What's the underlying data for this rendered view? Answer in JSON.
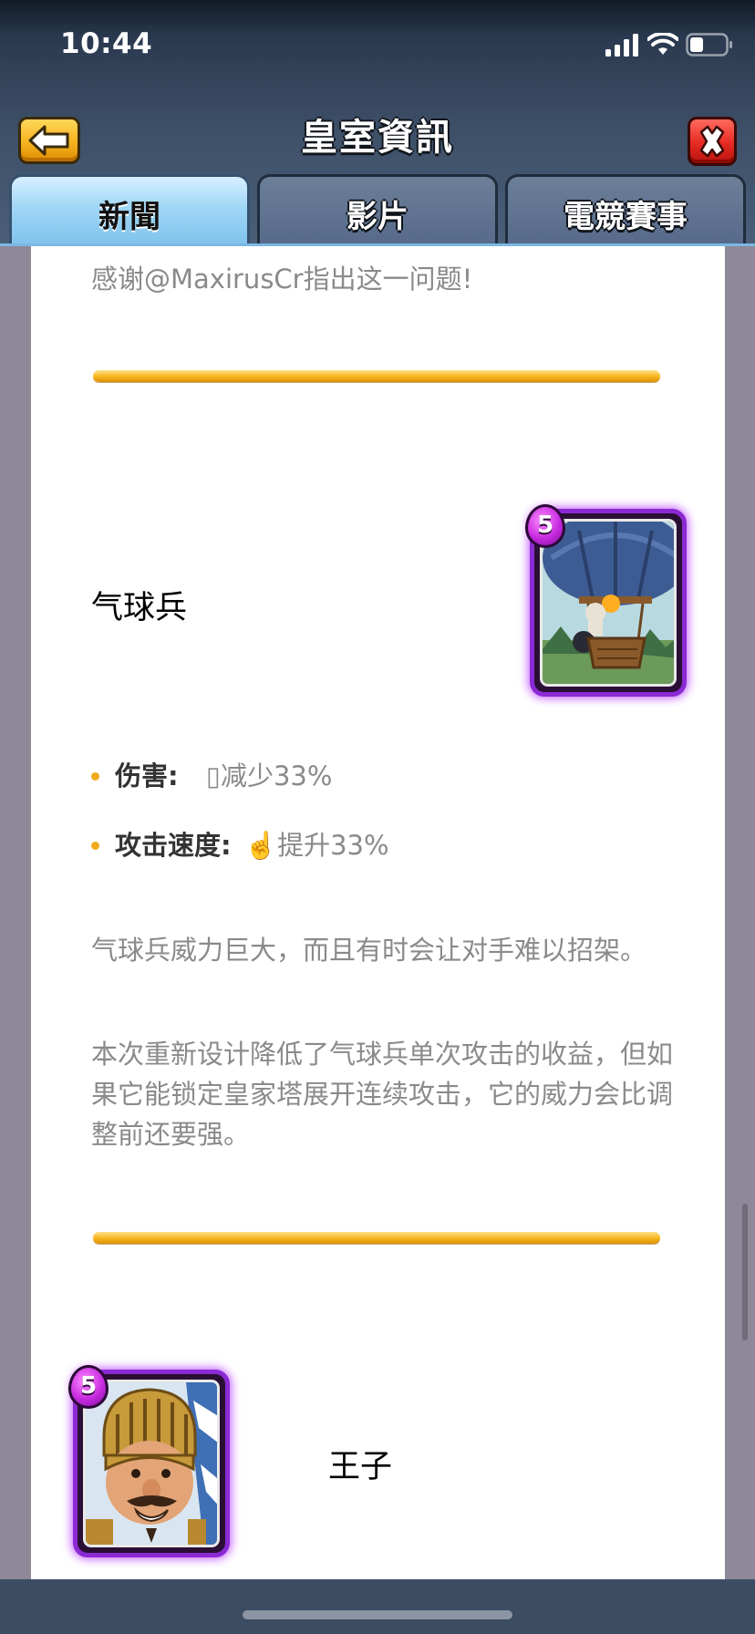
{
  "status_bar": {
    "time": "10:44",
    "icons": [
      "cellular-signal-icon",
      "wifi-icon",
      "battery-icon"
    ]
  },
  "nav": {
    "title": "皇室資訊",
    "back_icon": "back-arrow-icon",
    "close_icon": "close-icon"
  },
  "tabs": [
    {
      "label": "新聞",
      "active": true
    },
    {
      "label": "影片",
      "active": false
    },
    {
      "label": "電競賽事",
      "active": false
    }
  ],
  "article": {
    "thanks_text": "感谢@MaxirusCr指出这一问题!",
    "balloon": {
      "name": "气球兵",
      "elixir_cost": "5",
      "stats": [
        {
          "label": "伤害:",
          "value": "▯减少33%"
        },
        {
          "label": "攻击速度:",
          "value": "☝️提升33%"
        }
      ],
      "description_1": "气球兵威力巨大，而且有时会让对手难以招架。",
      "description_2": "本次重新设计降低了气球兵单次攻击的收益，但如果它能锁定皇家塔展开连续攻击，它的威力会比调整前还要强。"
    },
    "prince": {
      "name": "王子",
      "elixir_cost": "5"
    }
  },
  "colors": {
    "accent_gold": "#f7b51c",
    "card_epic_purple": "#8b2ad4",
    "header_blue": "#3f5169",
    "tab_active": "#9fd6f6"
  }
}
